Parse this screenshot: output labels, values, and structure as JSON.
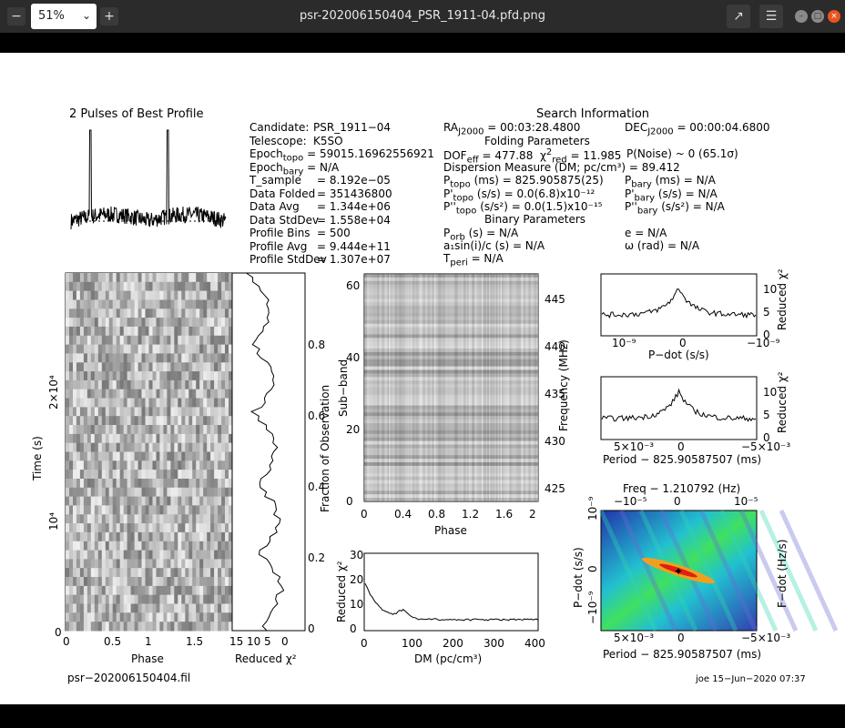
{
  "window": {
    "zoom": "51%",
    "title": "psr-202006150404_PSR_1911-04.pfd.png"
  },
  "plot": {
    "profile_title": "2 Pulses of Best Profile",
    "search_title": "Search Information",
    "candidate": [
      "Candidate:",
      "PSR_1911−04"
    ],
    "telescope": [
      "Telescope:",
      "K5SO"
    ],
    "epoch_topo": "59015.16962556921",
    "epoch_bary": "= N/A",
    "info_rows": [
      {
        "label": "T_sample",
        "value": "8.192e−05"
      },
      {
        "label": "Data Folded",
        "value": "351436800"
      },
      {
        "label": "Data Avg",
        "value": "1.344e+06"
      },
      {
        "label": "Data StdDev",
        "value": "1.558e+04"
      },
      {
        "label": "Profile Bins",
        "value": "500"
      },
      {
        "label": "Profile Avg",
        "value": "9.444e+11"
      },
      {
        "label": "Profile StdDev",
        "value": "1.307e+07"
      }
    ],
    "ra": "= 00:03:28.4800",
    "dec": "= 00:00:04.6800",
    "folding_title": "Folding Parameters",
    "dof": "= 477.88",
    "chi2": "= 11.985",
    "pnoise": "P(Noise) ~ 0    (65.1σ)",
    "dm_line": "Dispersion Measure (DM; pc/cm³) = 89.412",
    "ptopo": "(ms)  =  825.905875(25)",
    "pdtopo": "(s/s) = 0.0(6.8)x10⁻¹²",
    "pddtopo": "(s/s²) = 0.0(1.5)x10⁻¹⁵",
    "pbary": "(ms) = N/A",
    "pdbary": "(s/s) = N/A",
    "pddbary": "(s/s²) = N/A",
    "binary_title": "Binary Parameters",
    "porb": "(s) = N/A",
    "asini": "a₁sin(i)/c (s) = N/A",
    "tperi": "= N/A",
    "ecc": "e = N/A",
    "omega": "ω (rad) = N/A",
    "time_axis": {
      "label": "Time (s)",
      "ticks": [
        "0",
        "10⁴",
        "2×10⁴"
      ],
      "xticks": [
        "0",
        "0.5",
        "1",
        "1.5"
      ],
      "xlabel": "Phase"
    },
    "redchi_axis": {
      "xticks": [
        "15",
        "10",
        "5",
        "0"
      ],
      "xlabel": "Reduced χ²",
      "yticks": [
        "0",
        "0.2",
        "0.4",
        "0.6",
        "0.8"
      ],
      "ylabel": "Fraction of Observation"
    },
    "subband": {
      "ylabel": "Sub−band",
      "yticks": [
        "0",
        "20",
        "40",
        "60"
      ],
      "xticks": [
        "0",
        "0.4",
        "0.8",
        "1.2",
        "1.6",
        "2"
      ],
      "xlabel": "Phase",
      "freq_label": "Frequency (MHz)",
      "freq_ticks": [
        "425",
        "430",
        "435",
        "440",
        "445"
      ]
    },
    "dm_plot": {
      "ylabel": "Reduced χ²",
      "yticks": [
        "0",
        "10",
        "20",
        "30"
      ],
      "xticks": [
        "0",
        "100",
        "200",
        "300",
        "400"
      ],
      "xlabel": "DM (pc/cm³)"
    },
    "pdot_plot": {
      "xlabel": "P−dot (s/s)",
      "ylabel": "Reduced χ²",
      "yticks": [
        "0",
        "5",
        "10"
      ],
      "xticks": [
        "10⁻⁹",
        "0",
        "−10⁻⁹"
      ]
    },
    "period_plot": {
      "xlabel": "Period − 825.90587507 (ms)",
      "ylabel": "Reduced χ²",
      "yticks": [
        "0",
        "5",
        "10"
      ],
      "xticks": [
        "5×10⁻³",
        "0",
        "−5×10⁻³"
      ]
    },
    "pp_plot": {
      "top_label": "Freq − 1.210792 (Hz)",
      "top_ticks": [
        "−10⁻⁵",
        "0",
        "10⁻⁵"
      ],
      "ylabel": "P−dot (s/s)",
      "yticks": [
        "−10⁻⁹",
        "0",
        "10⁻⁹"
      ],
      "right_label": "F−dot (Hz/s)",
      "xlabel": "Period − 825.90587507 (ms)",
      "xticks": [
        "5×10⁻³",
        "0",
        "−5×10⁻³"
      ]
    },
    "filename": "psr−202006150404.fil",
    "stamp": "joe  15−Jun−2020  07:37"
  }
}
